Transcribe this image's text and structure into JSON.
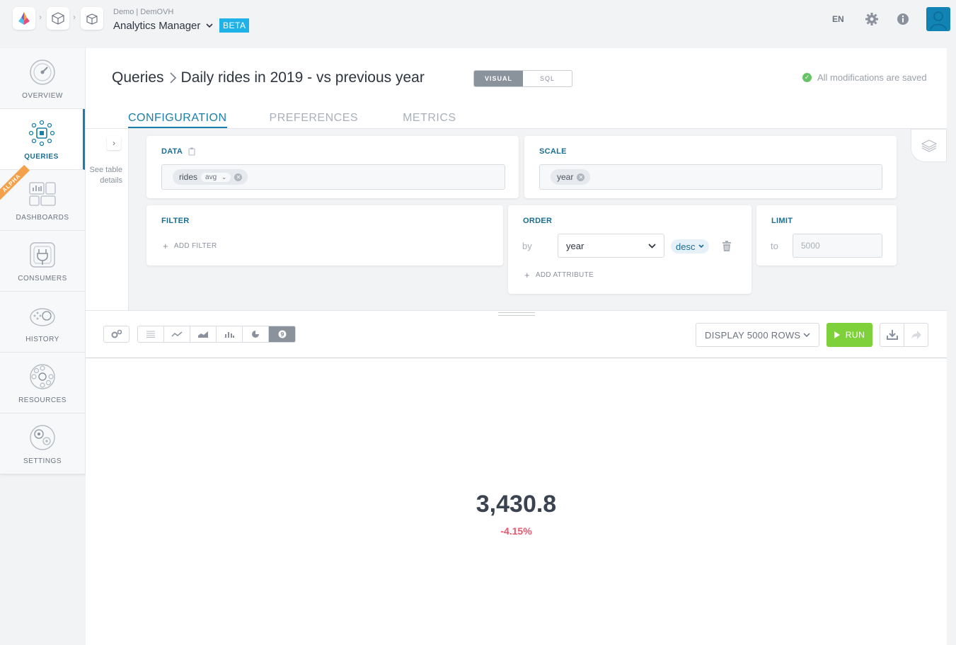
{
  "header": {
    "context_small": "Demo | DemOVH",
    "app_title": "Analytics Manager",
    "beta": "BETA",
    "language": "EN",
    "icons": [
      "logo-icon",
      "cube-icon",
      "box-icon",
      "gear-icon",
      "info-icon",
      "avatar"
    ]
  },
  "sidebar": {
    "items": [
      {
        "label": "OVERVIEW",
        "icon": "speedometer-icon"
      },
      {
        "label": "QUERIES",
        "icon": "queries-icon",
        "active": true
      },
      {
        "label": "DASHBOARDS",
        "icon": "dashboards-icon"
      },
      {
        "label": "CONSUMERS",
        "icon": "plug-icon"
      },
      {
        "label": "HISTORY",
        "icon": "history-icon"
      },
      {
        "label": "RESOURCES",
        "icon": "resources-icon"
      },
      {
        "label": "SETTINGS",
        "icon": "settings-icon"
      }
    ],
    "ribbon": "ALPHA"
  },
  "page": {
    "crumb_root": "Queries",
    "crumb_current": "Daily rides in 2019 - vs previous year",
    "mode_visual": "VISUAL",
    "mode_sql": "SQL",
    "saved_status": "All modifications are saved",
    "tabs": [
      "CONFIGURATION",
      "PREFERENCES",
      "METRICS"
    ]
  },
  "config": {
    "see_table_details": "See table details",
    "data": {
      "title": "DATA",
      "chip": "rides",
      "aggregation": "avg"
    },
    "scale": {
      "title": "SCALE",
      "chip": "year"
    },
    "filter": {
      "title": "FILTER",
      "add_label": "ADD FILTER"
    },
    "order": {
      "title": "ORDER",
      "by_label": "by",
      "attribute": "year",
      "direction": "desc",
      "add_label": "ADD ATTRIBUTE"
    },
    "limit": {
      "title": "LIMIT",
      "to_label": "to",
      "placeholder": "5000"
    }
  },
  "toolbar": {
    "display_rows": "DISPLAY 5000 ROWS",
    "run": "RUN",
    "viz_types": [
      "table-icon",
      "line-chart-icon",
      "area-chart-icon",
      "bar-chart-icon",
      "pie-chart-icon",
      "number-icon"
    ],
    "selected_viz": "number-icon"
  },
  "result": {
    "value": "3,430.8",
    "change": "-4.15%",
    "change_color": "#e8566b"
  },
  "colors": {
    "accent": "#1a7fa8",
    "run": "#7fd13b",
    "beta": "#1fb2e8"
  }
}
